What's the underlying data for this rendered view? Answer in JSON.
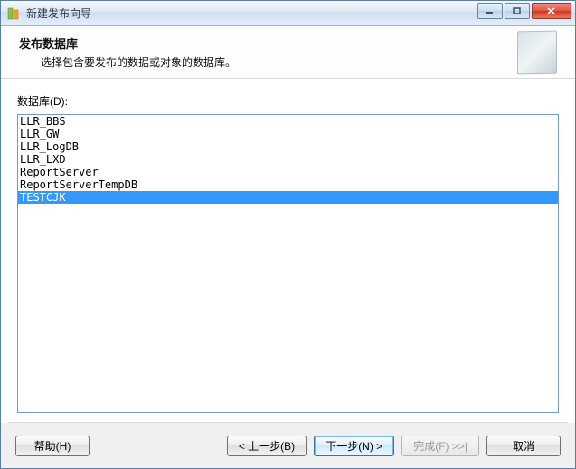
{
  "window": {
    "title": "新建发布向导"
  },
  "header": {
    "title": "发布数据库",
    "subtitle": "选择包含要发布的数据或对象的数据库。"
  },
  "content": {
    "label": "数据库(D):",
    "databases": [
      {
        "name": "LLR_BBS",
        "selected": false
      },
      {
        "name": "LLR_GW",
        "selected": false
      },
      {
        "name": "LLR_LogDB",
        "selected": false
      },
      {
        "name": "LLR_LXD",
        "selected": false
      },
      {
        "name": "ReportServer",
        "selected": false
      },
      {
        "name": "ReportServerTempDB",
        "selected": false
      },
      {
        "name": "TESTCJK",
        "selected": true
      }
    ]
  },
  "footer": {
    "help": "帮助(H)",
    "back": "< 上一步(B)",
    "next": "下一步(N) >",
    "finish": "完成(F) >>|",
    "cancel": "取消"
  }
}
